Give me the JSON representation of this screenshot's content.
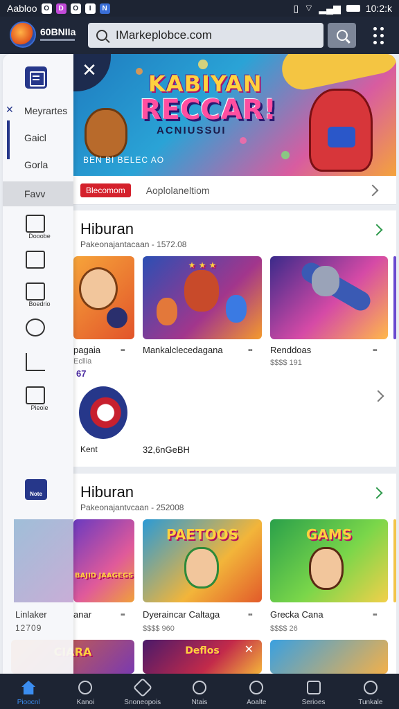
{
  "status_bar": {
    "left_text": "Aabloo",
    "icons": [
      "O",
      "D",
      "O",
      "I",
      "N"
    ],
    "time": "10:2:k"
  },
  "header": {
    "brand": "60BNIIa",
    "search_value": "IMarkeplobce.com"
  },
  "hero": {
    "title_line1": "KABIYAN",
    "title_line2": "RECCAR!",
    "subtitle": "ACNIUSSUI",
    "caption": "BEN BI BELEC AO",
    "badge": "Blecomom",
    "bar_text": "Aoplolaneltiom"
  },
  "sidebar": {
    "items": [
      {
        "label": "Meyrartes"
      },
      {
        "label": "Gaicl"
      },
      {
        "label": "Gorla"
      },
      {
        "label": "Favv"
      }
    ],
    "icon_labels": [
      "Dooobe",
      "",
      "Boedrio",
      "",
      "",
      "Pieoie"
    ],
    "bottom_icon_label": "Note",
    "tile_name": "Linlaker",
    "tile_meta": "12709"
  },
  "section1": {
    "title": "Hiburan",
    "subtitle": "Pakeonajantacaan - 1572.08",
    "tiles": [
      {
        "name": "pagaia",
        "meta": "Ecllia",
        "extra": "67"
      },
      {
        "name": "Mankalclecedagana",
        "meta": ""
      },
      {
        "name": "Renddoas",
        "meta": "$$$$ 191"
      }
    ],
    "app_name": "Kent",
    "app_meta": "32,6nGeBH"
  },
  "section2": {
    "title": "Hiburan",
    "subtitle": "Pakeonajantvcaan - 252008",
    "tiles": [
      {
        "name": "anar",
        "art": "BAJID JAAGEGS"
      },
      {
        "name": "Dyeraincar Caltaga",
        "meta": "$$$$ 960",
        "art": "PAETOOS"
      },
      {
        "name": "Grecka Cana",
        "meta": "$$$$ 26",
        "art": "GAMS"
      }
    ],
    "row3_art": [
      "CIARA",
      "Deflos",
      ""
    ]
  },
  "bottom_nav": [
    {
      "label": "Pioocnl",
      "icon": "home-icon"
    },
    {
      "label": "Kanoi",
      "icon": "pin-icon"
    },
    {
      "label": "Snoneopois",
      "icon": "gear-icon"
    },
    {
      "label": "Ntais",
      "icon": "compass-icon"
    },
    {
      "label": "Aoalte",
      "icon": "search-icon"
    },
    {
      "label": "Serioes",
      "icon": "square-icon"
    },
    {
      "label": "Tunkale",
      "icon": "person-icon"
    }
  ],
  "colors": {
    "header_bg": "#1f2738",
    "accent_blue": "#26378a",
    "badge_red": "#d4212c",
    "chevron_green": "#2e9a4c",
    "nav_active": "#3b8df0"
  }
}
